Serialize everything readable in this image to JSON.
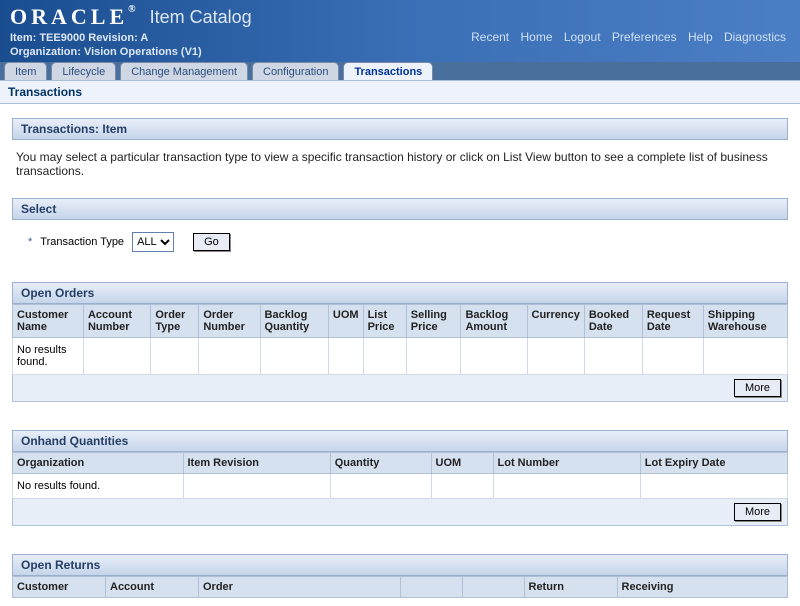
{
  "header": {
    "brand": "ORACLE",
    "app_title": "Item Catalog",
    "item_line": "Item: TEE9000  Revision: A",
    "org_line": "Organization: Vision Operations (V1)",
    "links": {
      "recent": "Recent",
      "home": "Home",
      "logout": "Logout",
      "preferences": "Preferences",
      "help": "Help",
      "diagnostics": "Diagnostics"
    }
  },
  "tabs": {
    "item": "Item",
    "lifecycle": "Lifecycle",
    "change": "Change Management",
    "configuration": "Configuration",
    "transactions": "Transactions"
  },
  "breadcrumb": "Transactions",
  "sections": {
    "page_title": "Transactions: Item",
    "description": "You may select a particular transaction type to view a specific transaction history or click on List View button to see a complete list of business transactions.",
    "select_title": "Select",
    "txn_type_label": "Transaction Type",
    "txn_type_value": "ALL",
    "go_label": "Go",
    "open_orders_title": "Open Orders",
    "onhand_title": "Onhand Quantities",
    "open_returns_title": "Open Returns",
    "more_label": "More",
    "no_results": "No results found."
  },
  "open_orders_cols": {
    "c0": "Customer Name",
    "c1": "Account Number",
    "c2": "Order Type",
    "c3": "Order Number",
    "c4": "Backlog Quantity",
    "c5": "UOM",
    "c6": "List Price",
    "c7": "Selling Price",
    "c8": "Backlog Amount",
    "c9": "Currency",
    "c10": "Booked Date",
    "c11": "Request Date",
    "c12": "Shipping Warehouse"
  },
  "onhand_cols": {
    "c0": "Organization",
    "c1": "Item Revision",
    "c2": "Quantity",
    "c3": "UOM",
    "c4": "Lot Number",
    "c5": "Lot Expiry Date"
  },
  "open_returns_cols": {
    "c0": "Customer",
    "c1": "Account",
    "c2": "Order",
    "c5": "Return",
    "c6": "Receiving"
  }
}
